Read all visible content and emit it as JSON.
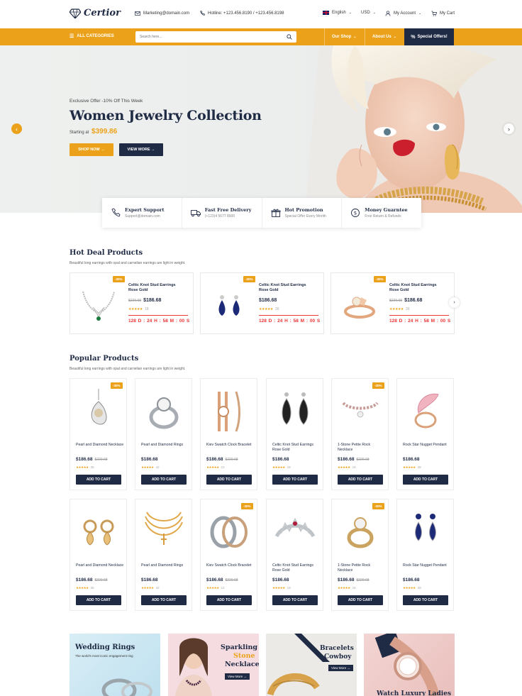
{
  "header": {
    "logo": "Certior",
    "email": "Marketing@domain.com",
    "hotline": "Hotline: +123.456.8190 / +123.456.8198",
    "language": "English",
    "currency": "USD",
    "account": "My Account",
    "cart": "My Cart"
  },
  "nav": {
    "categories": "ALL CATEGORIES",
    "search_placeholder": "Search here...",
    "shop": "Our Shop",
    "about": "About Us",
    "special": "Special Offers!"
  },
  "hero": {
    "offer": "Exclusive Offer -10% Off This Week",
    "title": "Women Jewelry Collection",
    "starting": "Starting at",
    "price": "$399.86",
    "shop_now": "SHOP NOW →",
    "view_more": "VIEW MORE →"
  },
  "features": [
    {
      "title": "Expert Support",
      "sub": "Support@domain.com",
      "icon": "phone-icon"
    },
    {
      "title": "Fast Free Delivery",
      "sub": "(+123)4 5677 8900",
      "icon": "truck-icon"
    },
    {
      "title": "Hot Promotion",
      "sub": "Special Offer Every Month",
      "icon": "gift-icon"
    },
    {
      "title": "Money Guarntee",
      "sub": "Free Return & Refunds",
      "icon": "money-icon"
    }
  ],
  "hot_deal": {
    "title": "Hot Deal Products",
    "sub": "Beautiful long earrings with opal and carnelian earrings are light in weight.",
    "items": [
      {
        "badge": "-30%",
        "name": "Celtic Knot Stud Earrings Rose Gold",
        "old": "$229.68",
        "price": "$186.68",
        "stars": "★★★★★",
        "count": "18",
        "timer": "128 D : 24 H : 58 M : 00 S"
      },
      {
        "badge": "-30%",
        "name": "Celtic Knot Stud Earrings Rose Gold",
        "old": "",
        "price": "$186.68",
        "stars": "★★★★★",
        "count": "36",
        "timer": "128 D : 24 H : 58 M : 00 S"
      },
      {
        "badge": "-30%",
        "name": "Celtic Knot Stud Earrings Rose Gold",
        "old": "$229.68",
        "price": "$186.68",
        "stars": "★★★★★",
        "count": "36",
        "timer": "128 D : 24 H : 58 M : 00 S"
      }
    ]
  },
  "popular": {
    "title": "Popular Products",
    "sub": "Beautiful long earrings with opal and carnelian earrings are light in weight.",
    "cta": "ADD TO CART",
    "row1": [
      {
        "badge": "-30%",
        "name": "Pearl and Diamond Necklace",
        "price": "$186.68",
        "old": "$229.68",
        "stars": "★★★★★",
        "count": "36"
      },
      {
        "badge": "",
        "name": "Pearl and Diamond Rings",
        "price": "$186.68",
        "old": "",
        "stars": "★★★★★",
        "count": "42"
      },
      {
        "badge": "",
        "name": "Kiev Swatch Clock Bracelet",
        "price": "$186.68",
        "old": "$229.68",
        "stars": "★★★★★",
        "count": "12"
      },
      {
        "badge": "",
        "name": "Celtic Knot Stud Earrings Rose Gold",
        "price": "$186.68",
        "old": "",
        "stars": "★★★★★",
        "count": "18"
      },
      {
        "badge": "-30%",
        "name": "1-Stone Petite Rock Necklace",
        "price": "$186.68",
        "old": "$229.68",
        "stars": "★★★★★",
        "count": "16"
      },
      {
        "badge": "",
        "name": "Rock Star Nugget Pendant",
        "price": "$186.68",
        "old": "",
        "stars": "★★★★★",
        "count": "28"
      }
    ],
    "row2": [
      {
        "badge": "",
        "name": "Pearl and Diamond Necklace",
        "price": "$186.68",
        "old": "$229.68",
        "stars": "★★★★★",
        "count": "36"
      },
      {
        "badge": "",
        "name": "Pearl and Diamond Rings",
        "price": "$186.68",
        "old": "",
        "stars": "★★★★★",
        "count": "42"
      },
      {
        "badge": "-30%",
        "name": "Kiev Swatch Clock Bracelet",
        "price": "$186.68",
        "old": "$229.68",
        "stars": "★★★★★",
        "count": "12"
      },
      {
        "badge": "",
        "name": "Celtic Knot Stud Earrings Rose Gold",
        "price": "$186.68",
        "old": "",
        "stars": "★★★★★",
        "count": "18"
      },
      {
        "badge": "-30%",
        "name": "1-Stone Petite Rock Necklace",
        "price": "$186.68",
        "old": "$229.68",
        "stars": "★★★★★",
        "count": "16"
      },
      {
        "badge": "",
        "name": "Rock Star Nugget Pendant",
        "price": "$186.68",
        "old": "",
        "stars": "★★★★★",
        "count": "28"
      }
    ]
  },
  "banners": [
    {
      "title": "Wedding Rings",
      "sub": "The world's most iconic engagement ring"
    },
    {
      "title1": "Sparkling",
      "title2": "Stone",
      "title3": "Necklace",
      "cta": "View More →"
    },
    {
      "title1": "Bracelets",
      "title2": "Cowboy",
      "cta": "View More →"
    },
    {
      "title": "Watch Luxury Ladies"
    }
  ],
  "colors": {
    "accent": "#eba21a",
    "navy": "#1f2a44",
    "timer": "#e33333"
  }
}
